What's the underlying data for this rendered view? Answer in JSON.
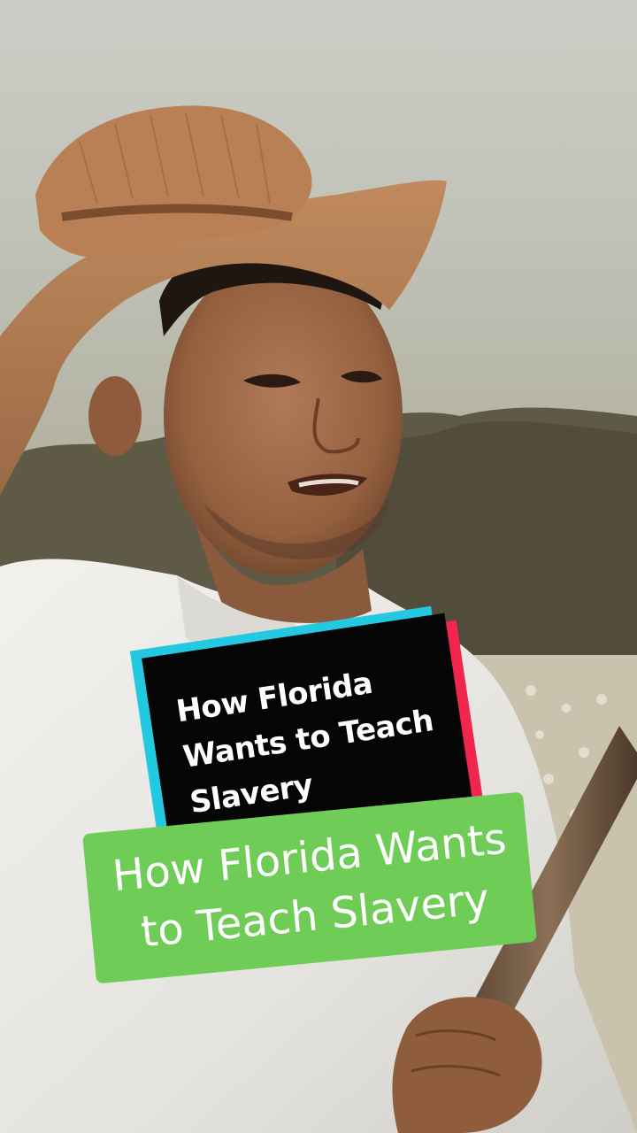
{
  "overlay": {
    "title_card": {
      "line1": "How Florida",
      "line2": "Wants to Teach",
      "line3": "Slavery",
      "colors": {
        "bg": "#050505",
        "accent_left": "#23c9e0",
        "accent_right": "#f0264f",
        "text": "#ffffff"
      }
    },
    "subtitle": {
      "line1": "How Florida Wants",
      "line2": "to Teach Slavery",
      "colors": {
        "bg": "#6fcd57",
        "text": "#ffffff"
      }
    }
  }
}
